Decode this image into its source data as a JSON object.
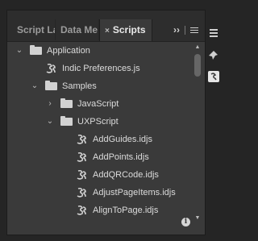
{
  "tabs": [
    {
      "label": "Script La",
      "active": false
    },
    {
      "label": "Data Me",
      "active": false
    },
    {
      "label": "Scripts",
      "active": true,
      "close": "×"
    }
  ],
  "header": {
    "overflow_label": "››",
    "menu_icon": "hamburger-menu-icon"
  },
  "tree": [
    {
      "type": "folder",
      "label": "Application",
      "depth": 0,
      "expanded": true
    },
    {
      "type": "script",
      "label": "Indic Preferences.js",
      "depth": 1
    },
    {
      "type": "folder",
      "label": "Samples",
      "depth": 1,
      "expanded": true
    },
    {
      "type": "folder",
      "label": "JavaScript",
      "depth": 2,
      "expanded": false
    },
    {
      "type": "folder",
      "label": "UXPScript",
      "depth": 2,
      "expanded": true
    },
    {
      "type": "script",
      "label": "AddGuides.idjs",
      "depth": 3
    },
    {
      "type": "script",
      "label": "AddPoints.idjs",
      "depth": 3
    },
    {
      "type": "script",
      "label": "AddQRCode.idjs",
      "depth": 3
    },
    {
      "type": "script",
      "label": "AdjustPageItems.idjs",
      "depth": 3
    },
    {
      "type": "script",
      "label": "AlignToPage.idjs",
      "depth": 3
    }
  ],
  "footer": {
    "info_label": "i"
  },
  "colors": {
    "panel": "#3a3a3a",
    "tabbar": "#2d2d2d",
    "text": "#dcdcdc"
  }
}
